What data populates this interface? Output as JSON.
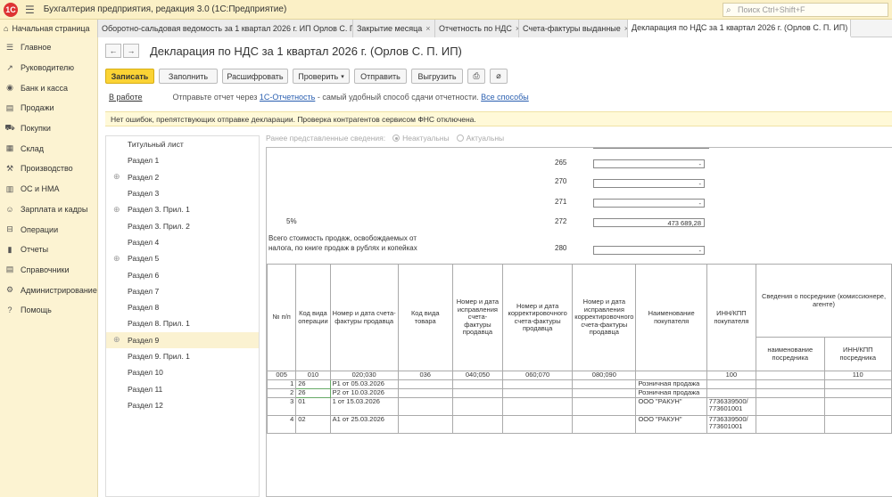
{
  "app": {
    "logo": "1С",
    "title": "Бухгалтерия предприятия, редакция 3.0  (1С:Предприятие)",
    "search_placeholder": "Поиск Ctrl+Shift+F"
  },
  "tabs": [
    {
      "label": "Начальная страница"
    },
    {
      "label": "Оборотно-сальдовая ведомость за 1 квартал 2026 г. ИП Орлов С. П."
    },
    {
      "label": "Закрытие месяца"
    },
    {
      "label": "Отчетность по НДС"
    },
    {
      "label": "Счета-фактуры выданные"
    },
    {
      "label": "Декларация по НДС за 1 квартал 2026 г. (Орлов С. П. ИП)"
    }
  ],
  "sidebar": [
    {
      "label": "Главное",
      "icon": "menu-icon"
    },
    {
      "label": "Руководителю",
      "icon": "chart-icon"
    },
    {
      "label": "Банк и касса",
      "icon": "bank-icon"
    },
    {
      "label": "Продажи",
      "icon": "sales-icon"
    },
    {
      "label": "Покупки",
      "icon": "cart-icon"
    },
    {
      "label": "Склад",
      "icon": "warehouse-icon"
    },
    {
      "label": "Производство",
      "icon": "production-icon"
    },
    {
      "label": "ОС и НМА",
      "icon": "assets-icon"
    },
    {
      "label": "Зарплата и кадры",
      "icon": "people-icon"
    },
    {
      "label": "Операции",
      "icon": "operations-icon"
    },
    {
      "label": "Отчеты",
      "icon": "reports-icon"
    },
    {
      "label": "Справочники",
      "icon": "catalog-icon"
    },
    {
      "label": "Администрирование",
      "icon": "gear-icon"
    },
    {
      "label": "Помощь",
      "icon": "help-icon"
    }
  ],
  "header": {
    "back": "←",
    "forward": "→",
    "title": "Декларация по НДС за 1 квартал 2026 г. (Орлов С. П. ИП)"
  },
  "toolbar": {
    "save": "Записать",
    "fill": "Заполнить",
    "decode": "Расшифровать",
    "check": "Проверить",
    "send": "Отправить",
    "export": "Выгрузить"
  },
  "status": {
    "state": "В работе",
    "text_before": "Отправьте отчет через",
    "link1": "1С-Отчетность",
    "text_after": "- самый удобный способ сдачи отчетности.",
    "link2": "Все способы"
  },
  "banner": "Нет ошибок, препятствующих отправке декларации. Проверка контрагентов сервисом ФНС отключена.",
  "sections": [
    {
      "label": "Титульный лист",
      "plus": ""
    },
    {
      "label": "Раздел 1",
      "plus": ""
    },
    {
      "label": "Раздел 2",
      "plus": "⊕"
    },
    {
      "label": "Раздел 3",
      "plus": ""
    },
    {
      "label": "Раздел 3. Прил. 1",
      "plus": "⊕"
    },
    {
      "label": "Раздел 3. Прил. 2",
      "plus": ""
    },
    {
      "label": "Раздел 4",
      "plus": ""
    },
    {
      "label": "Раздел 5",
      "plus": "⊕"
    },
    {
      "label": "Раздел 6",
      "plus": ""
    },
    {
      "label": "Раздел 7",
      "plus": ""
    },
    {
      "label": "Раздел 8",
      "plus": ""
    },
    {
      "label": "Раздел 8. Прил. 1",
      "plus": ""
    },
    {
      "label": "Раздел 9",
      "plus": "⊕"
    },
    {
      "label": "Раздел 9. Прил. 1",
      "plus": ""
    },
    {
      "label": "Раздел 10",
      "plus": ""
    },
    {
      "label": "Раздел 11",
      "plus": ""
    },
    {
      "label": "Раздел 12",
      "plus": ""
    }
  ],
  "prev": {
    "label": "Ранее представленные сведения:",
    "opt1": "Неактуальны",
    "opt2": "Актуальны"
  },
  "form": {
    "lines": [
      {
        "code": "265",
        "value": "-"
      },
      {
        "code": "270",
        "value": "-"
      },
      {
        "code": "271",
        "value": "-"
      },
      {
        "code": "272",
        "value": "473 689,28"
      },
      {
        "code": "280",
        "value": "-"
      }
    ],
    "pct": "5%",
    "exempt1": "Всего стоимость продаж, освобождаемых от",
    "exempt2": "налога, по книге продаж в рублях и копейках"
  },
  "table": {
    "h": {
      "n": "№ п/п",
      "op": "Код вида операции",
      "inv": "Номер и дата счета-фактуры продавца",
      "goods": "Код вида товара",
      "corr": "Номер и дата исправления счета-фактуры продавца",
      "adj": "Номер и дата корректировочного счета-фактуры продавца",
      "adjcorr": "Номер и дата исправления корректировочного счета-фактуры продавца",
      "buyer": "Наименование покупателя",
      "inn": "ИНН/КПП покупателя",
      "agent": "Сведения о посреднике (комиссионере, агенте)",
      "agent_name": "наименование посредника",
      "agent_inn": "ИНН/КПП посредника"
    },
    "codes": {
      "n": "005",
      "op": "010",
      "inv": "020;030",
      "goods": "036",
      "corr": "040;050",
      "adj": "060;070",
      "adjcorr": "080;090",
      "inn": "100",
      "agent_inn": "110"
    },
    "rows": [
      {
        "n": "1",
        "op": "26",
        "inv": "Р1 от 05.03.2026",
        "buyer": "Розничная продажа",
        "inn1": "",
        "inn2": ""
      },
      {
        "n": "2",
        "op": "26",
        "inv": "Р2 от 10.03.2026",
        "buyer": "Розничная продажа",
        "inn1": "",
        "inn2": ""
      },
      {
        "n": "3",
        "op": "01",
        "inv": "1 от 15.03.2026",
        "buyer": "ООО \"РАКУН\"",
        "inn1": "7736339500/",
        "inn2": "773601001"
      },
      {
        "n": "4",
        "op": "02",
        "inv": "А1 от 25.03.2026",
        "buyer": "ООО \"РАКУН\"",
        "inn1": "7736339500/",
        "inn2": "773601001"
      }
    ]
  }
}
